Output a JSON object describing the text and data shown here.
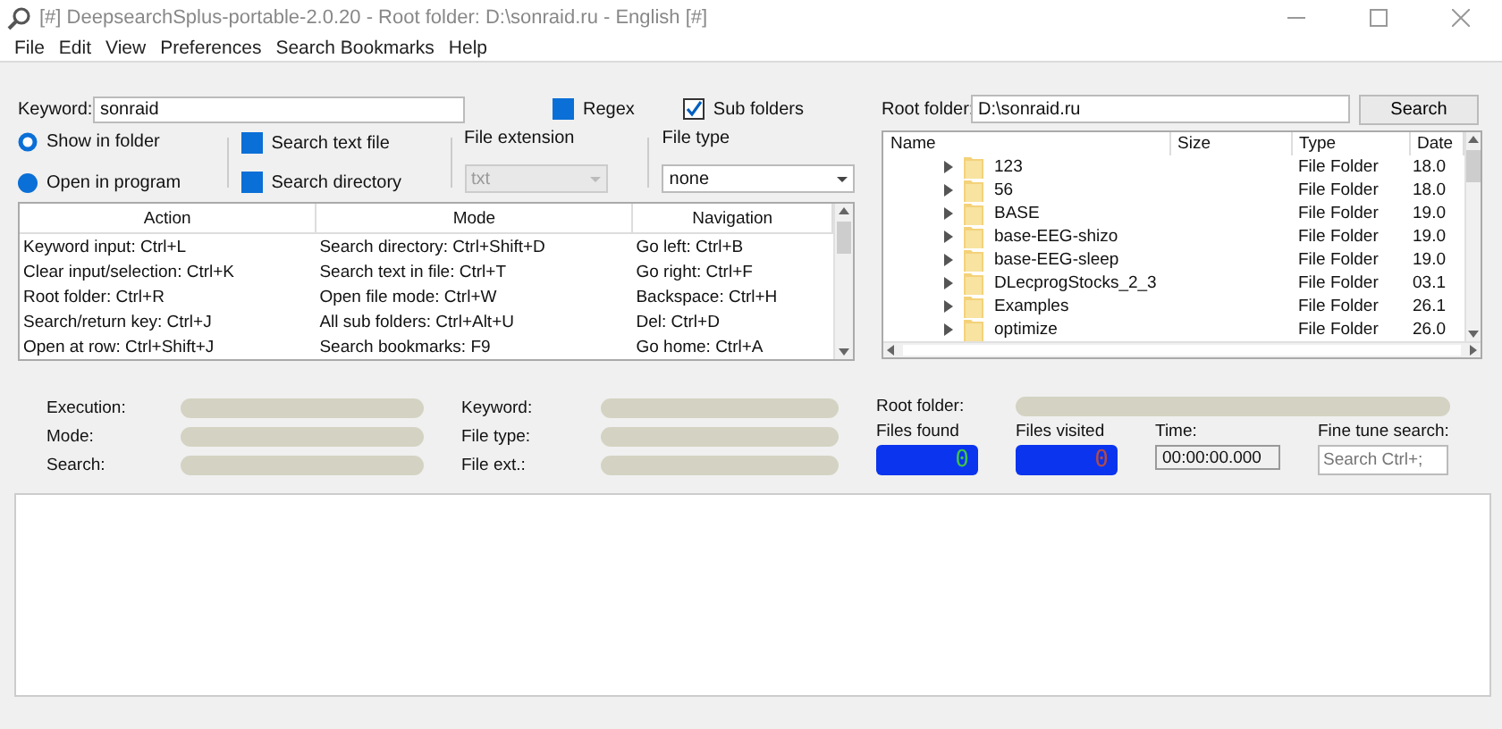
{
  "window": {
    "title": "[#] DeepsearchSplus-portable-2.0.20 - Root folder: D:\\sonraid.ru - English [#]"
  },
  "menu": [
    "File",
    "Edit",
    "View",
    "Preferences",
    "Search Bookmarks",
    "Help"
  ],
  "keyword": {
    "label": "Keyword:",
    "value": "sonraid"
  },
  "regex": {
    "label": "Regex",
    "checked": false
  },
  "sub_folders": {
    "label": "Sub folders",
    "checked": true
  },
  "open_mode": [
    {
      "label": "Show in folder",
      "selected": false
    },
    {
      "label": "Open in program",
      "selected": true
    }
  ],
  "search_mode": [
    {
      "label": "Search text file",
      "checked": false
    },
    {
      "label": "Search directory",
      "checked": false
    }
  ],
  "file_extension": {
    "label": "File extension",
    "value": "txt",
    "disabled": true
  },
  "file_type": {
    "label": "File type",
    "value": "none",
    "disabled": false
  },
  "shortcuts": {
    "columns": [
      "Action",
      "Mode",
      "Navigation"
    ],
    "rows": [
      [
        "Keyword input: Ctrl+L",
        "Search directory: Ctrl+Shift+D",
        "Go left: Ctrl+B"
      ],
      [
        "Clear input/selection: Ctrl+K",
        "Search text in file: Ctrl+T",
        "Go right: Ctrl+F"
      ],
      [
        "Root folder: Ctrl+R",
        "Open file mode: Ctrl+W",
        "Backspace: Ctrl+H"
      ],
      [
        "Search/return key: Ctrl+J",
        "All sub folders: Ctrl+Alt+U",
        "Del: Ctrl+D"
      ],
      [
        "Open at row: Ctrl+Shift+J",
        "Search bookmarks: F9",
        "Go home: Ctrl+A"
      ]
    ]
  },
  "root_folder": {
    "label": "Root folder:",
    "value": "D:\\sonraid.ru",
    "button": "Search"
  },
  "files": {
    "columns": [
      "Name",
      "Size",
      "Type",
      "Date"
    ],
    "rows": [
      {
        "name": "123",
        "type": "File Folder",
        "date": "18.0"
      },
      {
        "name": "56",
        "type": "File Folder",
        "date": "18.0"
      },
      {
        "name": "BASE",
        "type": "File Folder",
        "date": "19.0"
      },
      {
        "name": "base-EEG-shizo",
        "type": "File Folder",
        "date": "19.0"
      },
      {
        "name": "base-EEG-sleep",
        "type": "File Folder",
        "date": "19.0"
      },
      {
        "name": "DLecprogStocks_2_3",
        "type": "File Folder",
        "date": "03.1"
      },
      {
        "name": "Examples",
        "type": "File Folder",
        "date": "26.1"
      },
      {
        "name": "optimize",
        "type": "File Folder",
        "date": "26.0"
      }
    ]
  },
  "status": {
    "left": [
      "Execution:",
      "Mode:",
      "Search:"
    ],
    "middle": [
      "Keyword:",
      "File type:",
      "File ext.:"
    ],
    "root_folder": "Root folder:",
    "files_found": {
      "label": "Files found",
      "value": "0",
      "color": "#3fc24a"
    },
    "files_visited": {
      "label": "Files visited",
      "value": "0",
      "color": "#b04a4a"
    },
    "time": {
      "label": "Time:",
      "value": "00:00:00.000"
    },
    "fine_tune": {
      "label": "Fine tune search:",
      "placeholder": "Search Ctrl+;"
    }
  }
}
